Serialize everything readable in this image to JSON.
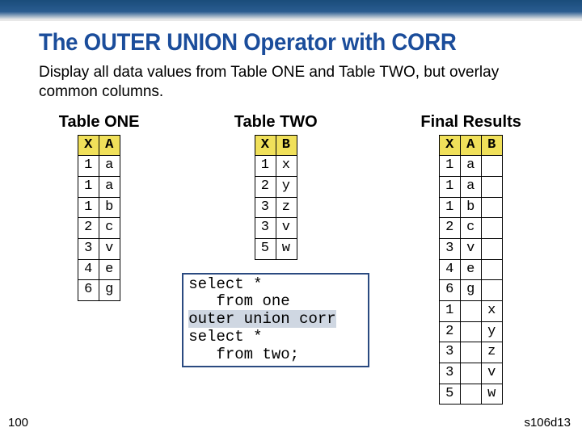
{
  "title": "The OUTER UNION Operator with CORR",
  "subtitle": "Display all data values from Table ONE and Table TWO, but overlay common columns.",
  "labels": {
    "table1": "Table ONE",
    "table2": "Table TWO",
    "table3": "Final Results"
  },
  "chart_data": [
    {
      "type": "table",
      "title": "Table ONE",
      "columns": [
        "X",
        "A"
      ],
      "rows": [
        [
          "1",
          "a"
        ],
        [
          "1",
          "a"
        ],
        [
          "1",
          "b"
        ],
        [
          "2",
          "c"
        ],
        [
          "3",
          "v"
        ],
        [
          "4",
          "e"
        ],
        [
          "6",
          "g"
        ]
      ]
    },
    {
      "type": "table",
      "title": "Table TWO",
      "columns": [
        "X",
        "B"
      ],
      "rows": [
        [
          "1",
          "x"
        ],
        [
          "2",
          "y"
        ],
        [
          "3",
          "z"
        ],
        [
          "3",
          "v"
        ],
        [
          "5",
          "w"
        ]
      ]
    },
    {
      "type": "table",
      "title": "Final Results",
      "columns": [
        "X",
        "A",
        "B"
      ],
      "rows": [
        [
          "1",
          "a",
          ""
        ],
        [
          "1",
          "a",
          ""
        ],
        [
          "1",
          "b",
          ""
        ],
        [
          "2",
          "c",
          ""
        ],
        [
          "3",
          "v",
          ""
        ],
        [
          "4",
          "e",
          ""
        ],
        [
          "6",
          "g",
          ""
        ],
        [
          "1",
          "",
          "x"
        ],
        [
          "2",
          "",
          "y"
        ],
        [
          "3",
          "",
          "z"
        ],
        [
          "3",
          "",
          "v"
        ],
        [
          "5",
          "",
          "w"
        ]
      ]
    }
  ],
  "code": {
    "l1": "select *",
    "l2": "   from one",
    "l3": "outer union corr",
    "l4": "select *",
    "l5": "   from two;"
  },
  "footer": {
    "page": "100",
    "slide_id": "s106d13"
  }
}
